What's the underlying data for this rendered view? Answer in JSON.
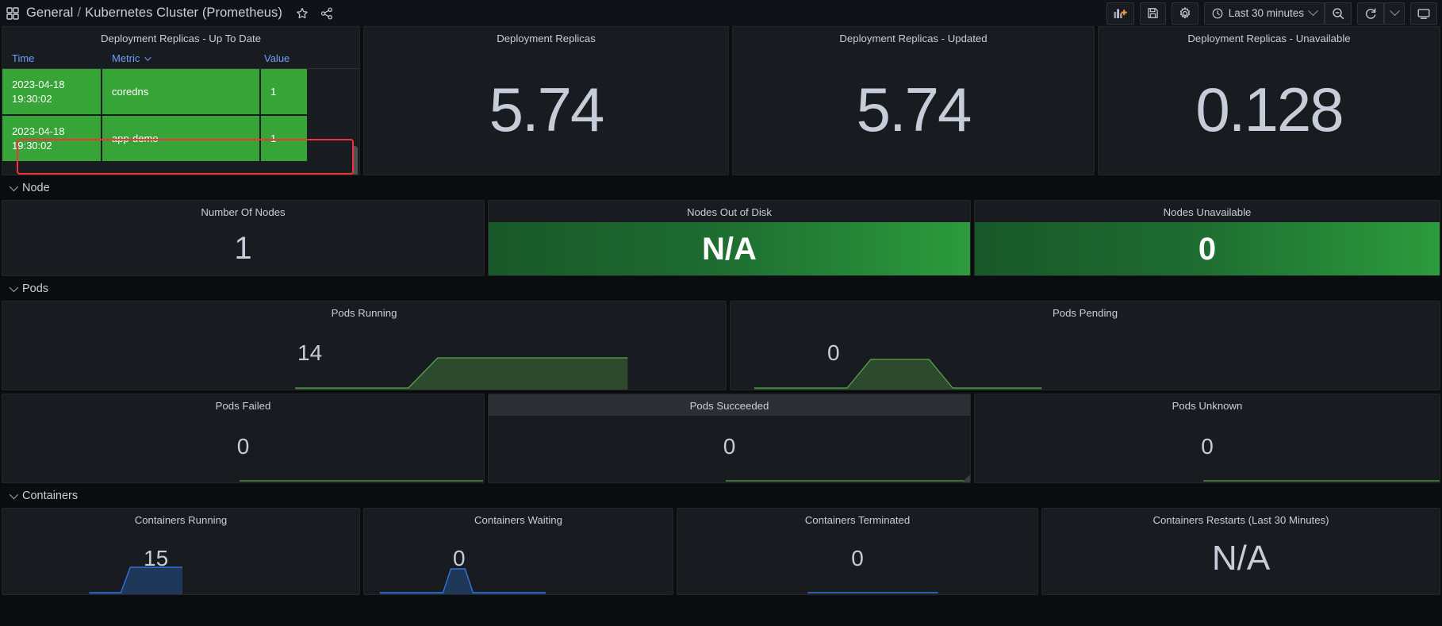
{
  "topnav": {
    "grid_icon": "grid-icon",
    "breadcrumb_folder": "General",
    "breadcrumb_sep": "/",
    "breadcrumb_dashboard": "Kubernetes Cluster (Prometheus)",
    "star_icon": "star-icon",
    "share_icon": "share-icon",
    "add_panel_icon": "add-panel-icon",
    "save_icon": "save-icon",
    "settings_icon": "gear-icon",
    "clock_icon": "clock-icon",
    "time_range": "Last 30 minutes",
    "time_chevron": "chevron-down-icon",
    "zoom_out_icon": "zoom-out-icon",
    "refresh_icon": "refresh-icon",
    "refresh_chevron": "chevron-down-icon",
    "kiosk_icon": "tv-icon"
  },
  "table_panel": {
    "title": "Deployment Replicas - Up To Date",
    "columns": [
      "Time",
      "Metric",
      "Value"
    ],
    "sort_column": "Metric",
    "rows": [
      {
        "time": "2023-04-18",
        "time2": "19:30:02",
        "metric": "coredns",
        "value": "1"
      },
      {
        "time": "2023-04-18",
        "time2": "19:30:02",
        "metric": "app-demo",
        "value": "1"
      }
    ],
    "highlighted_row_index": 1,
    "highlight_color": "#f5323a",
    "cell_color": "#37a437"
  },
  "top_stats": [
    {
      "title": "Deployment Replicas",
      "value": "5.74"
    },
    {
      "title": "Deployment Replicas - Updated",
      "value": "5.74"
    },
    {
      "title": "Deployment Replicas - Unavailable",
      "value": "0.128"
    }
  ],
  "sections": {
    "node": {
      "label": "Node",
      "caret": "chevron-down-icon"
    },
    "pods": {
      "label": "Pods",
      "caret": "chevron-down-icon"
    },
    "containers": {
      "label": "Containers",
      "caret": "chevron-down-icon"
    }
  },
  "node_stats": [
    {
      "title": "Number Of Nodes",
      "value": "1",
      "bg": "none"
    },
    {
      "title": "Nodes Out of Disk",
      "value": "N/A",
      "bg": "green"
    },
    {
      "title": "Nodes Unavailable",
      "value": "0",
      "bg": "green"
    }
  ],
  "pods_stats_row1": [
    {
      "title": "Pods Running",
      "value": "14"
    },
    {
      "title": "Pods Pending",
      "value": "0"
    }
  ],
  "pods_stats_row2": [
    {
      "title": "Pods Failed",
      "value": "0",
      "highlight": false
    },
    {
      "title": "Pods Succeeded",
      "value": "0",
      "highlight": true
    },
    {
      "title": "Pods Unknown",
      "value": "0",
      "highlight": false
    }
  ],
  "containers_stats": [
    {
      "title": "Containers Running",
      "value": "15"
    },
    {
      "title": "Containers Waiting",
      "value": "0"
    },
    {
      "title": "Containers Terminated",
      "value": "0"
    },
    {
      "title": "Containers Restarts (Last 30 Minutes)",
      "value": "N/A"
    }
  ],
  "colors": {
    "panel_bg": "#181b1f",
    "page_bg": "#0b0c0e",
    "text": "#ccccdc",
    "stat_text": "#c7ccd9",
    "link_blue": "#6e9fff",
    "green": "#37a437",
    "green_grad_from": "#1f6b2c",
    "green_grad_to": "#2aa03a",
    "sparkline_green": "#56a64b",
    "sparkline_blue": "#3274d9",
    "highlight_red": "#f5323a"
  }
}
